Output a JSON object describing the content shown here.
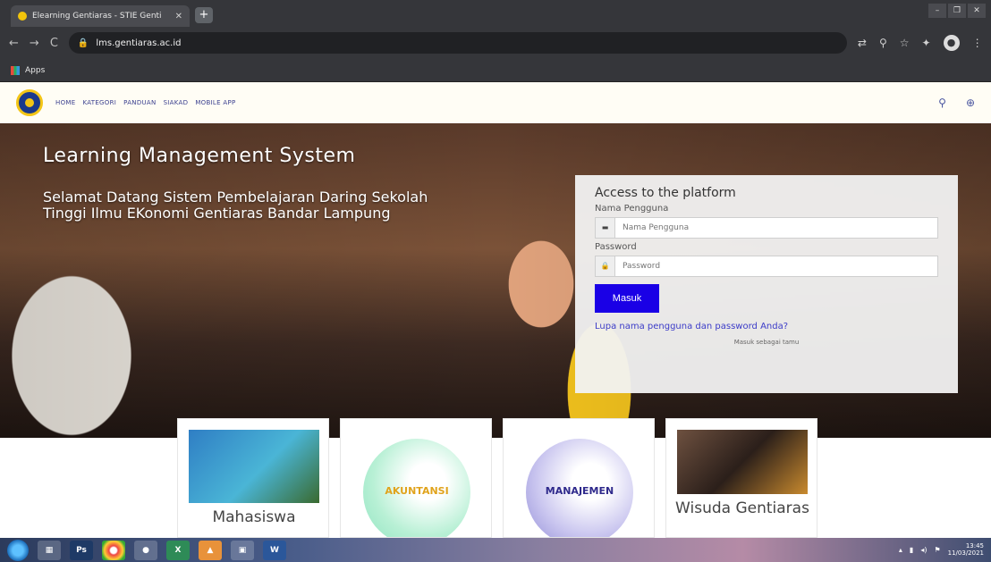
{
  "browser": {
    "tab_title": "Elearning Gentiaras - STIE Genti",
    "tab_close": "✕",
    "new_tab": "+",
    "url": "lms.gentiaras.ac.id",
    "bookmarks_label": "Apps",
    "nav": {
      "back": "←",
      "forward": "→",
      "reload": "C"
    },
    "toolbar_icons": [
      "translate-icon",
      "zoom-icon",
      "star-icon",
      "extension-icon",
      "profile-icon",
      "menu-icon"
    ]
  },
  "site": {
    "menu": [
      "HOME",
      "KATEGORI",
      "PANDUAN",
      "SIAKAD",
      "MOBILE APP"
    ],
    "hero_title": "Learning Management System",
    "hero_subtitle": "Selamat Datang Sistem Pembelajaran Daring Sekolah Tinggi Ilmu EKonomi Gentiaras Bandar Lampung"
  },
  "login": {
    "heading": "Access to the platform",
    "username_label": "Nama Pengguna",
    "username_placeholder": "Nama Pengguna",
    "password_label": "Password",
    "password_placeholder": "Password",
    "submit": "Masuk",
    "forgot": "Lupa nama pengguna dan password Anda?",
    "guest": "Masuk sebagai tamu"
  },
  "cards": [
    {
      "title": "Mahasiswa"
    },
    {
      "label": "AKUNTANSI"
    },
    {
      "label": "MANAJEMEN"
    },
    {
      "title": "Wisuda Gentiaras"
    }
  ],
  "taskbar": {
    "apps": [
      "Ps",
      "W"
    ],
    "time": "13:45",
    "date": "11/03/2021"
  },
  "colors": {
    "primary_button": "#1a00e6",
    "menu_text": "#3a3f8f",
    "link": "#3b3bc8"
  }
}
